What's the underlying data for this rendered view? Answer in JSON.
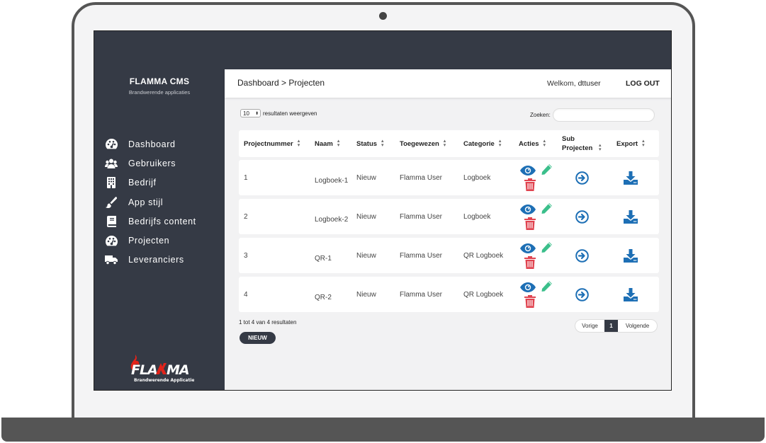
{
  "sidebar": {
    "brand_title": "FLAMMA CMS",
    "brand_subtitle": "Brandwerende applicaties",
    "items": [
      {
        "label": "Dashboard",
        "icon": "dashboard-icon"
      },
      {
        "label": "Gebruikers",
        "icon": "users-icon"
      },
      {
        "label": "Bedrijf",
        "icon": "building-icon"
      },
      {
        "label": "App stijl",
        "icon": "brush-icon"
      },
      {
        "label": "Bedrijfs content",
        "icon": "book-icon"
      },
      {
        "label": "Projecten",
        "icon": "dashboard-icon"
      },
      {
        "label": "Leveranciers",
        "icon": "truck-icon"
      }
    ],
    "logo_text": "FLAMMA",
    "logo_subtext": "Brandwerende Applicaties"
  },
  "header": {
    "breadcrumb": "Dashboard > Projecten",
    "welcome_prefix": "Welkom,",
    "username": "dttuser",
    "logout": "LOG OUT"
  },
  "controls": {
    "page_length": "10",
    "page_length_suffix": "resultaten weergeven",
    "search_label": "Zoeken:",
    "search_value": ""
  },
  "table": {
    "columns": [
      "Projectnummer",
      "Naam",
      "Status",
      "Toegewezen",
      "Categorie",
      "Acties",
      "Sub Projecten",
      "Export"
    ],
    "rows": [
      {
        "nummer": "1",
        "naam": "Logboek-1",
        "status": "Nieuw",
        "toegewezen": "Flamma User",
        "categorie": "Logboek"
      },
      {
        "nummer": "2",
        "naam": "Logboek-2",
        "status": "Nieuw",
        "toegewezen": "Flamma User",
        "categorie": "Logboek"
      },
      {
        "nummer": "3",
        "naam": "QR-1",
        "status": "Nieuw",
        "toegewezen": "Flamma User",
        "categorie": "QR Logboek"
      },
      {
        "nummer": "4",
        "naam": "QR-2",
        "status": "Nieuw",
        "toegewezen": "Flamma User",
        "categorie": "QR Logboek"
      }
    ]
  },
  "footer": {
    "info": "1 tot 4 van 4 resultaten",
    "new_button": "NIEUW",
    "prev": "Vorige",
    "current_page": "1",
    "next": "Volgende"
  },
  "colors": {
    "sidebar_bg": "#353a45",
    "eye": "#1d6fb5",
    "pencil": "#3bbf8b",
    "trash": "#e0434f",
    "sub_arrow": "#1d6fb5",
    "export": "#1d6fb5",
    "logo_red": "#e2231a"
  }
}
